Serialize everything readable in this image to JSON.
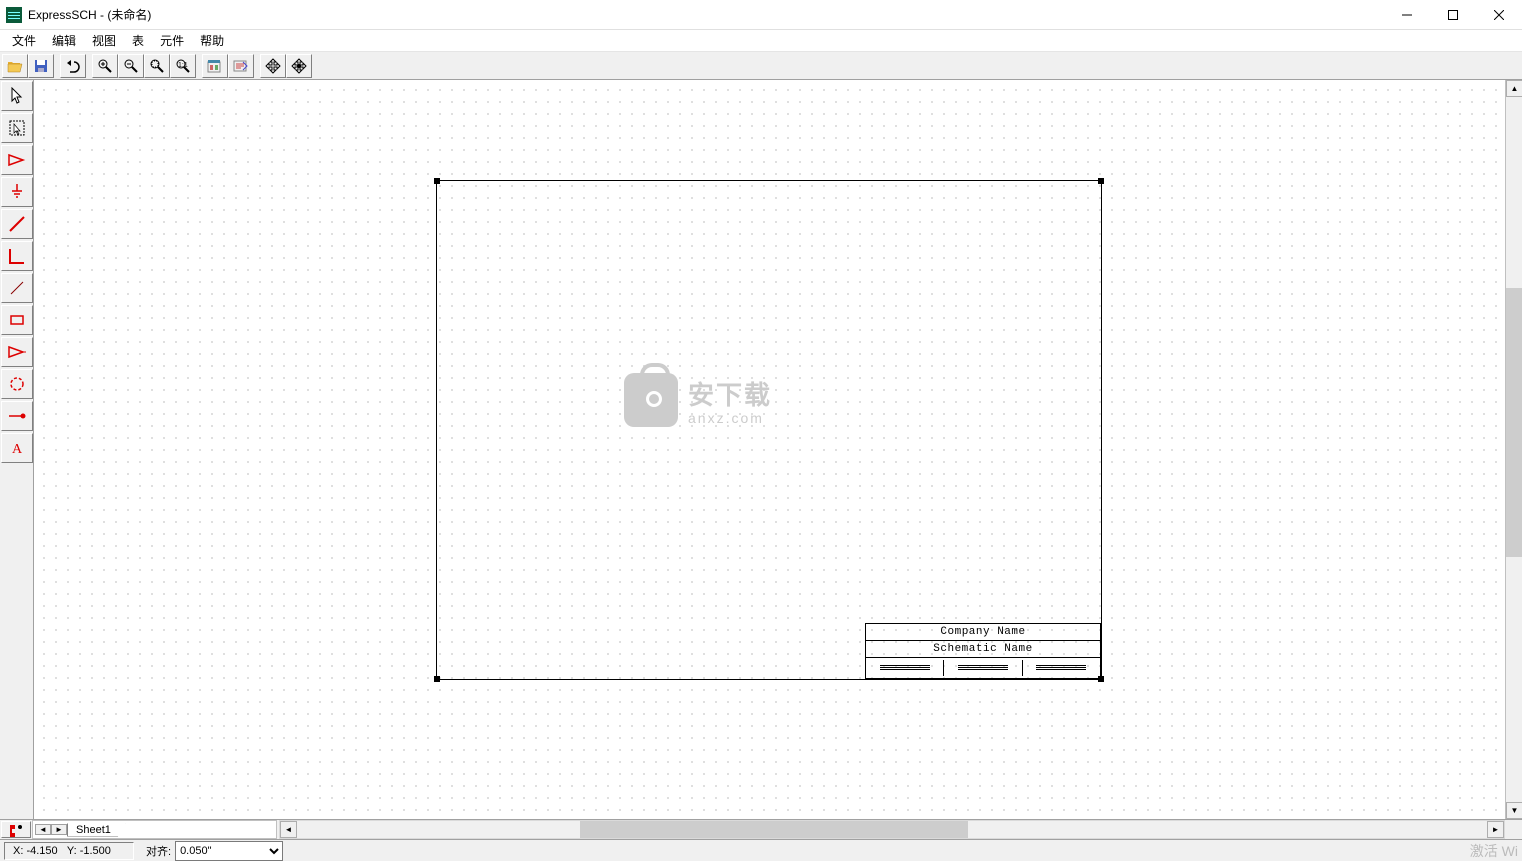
{
  "title": "ExpressSCH - (未命名)",
  "menu": [
    "文件",
    "编辑",
    "视图",
    "表",
    "元件",
    "帮助"
  ],
  "toolbar_icons": [
    "open",
    "save",
    "undo",
    "zoom-in",
    "zoom-out",
    "zoom-window",
    "zoom-fit",
    "options1",
    "options2",
    "move-center",
    "move-rotate"
  ],
  "vtool_icons": [
    "pointer",
    "select-area",
    "gate",
    "ground",
    "wire",
    "corner",
    "pin",
    "rectangle",
    "gate2",
    "circle",
    "net-label",
    "text"
  ],
  "snap_icon": "snap-toggle",
  "sheet_tab": "Sheet1",
  "title_block": {
    "company": "Company Name",
    "schematic": "Schematic Name"
  },
  "watermark": {
    "main": "安下载",
    "sub": "anxz.com"
  },
  "status": {
    "x_label": "X:",
    "x_val": "-4.150",
    "y_label": "Y:",
    "y_val": "-1.500",
    "align_label": "对齐:",
    "align_value": "0.050\"",
    "activate": "激活 Wi"
  }
}
